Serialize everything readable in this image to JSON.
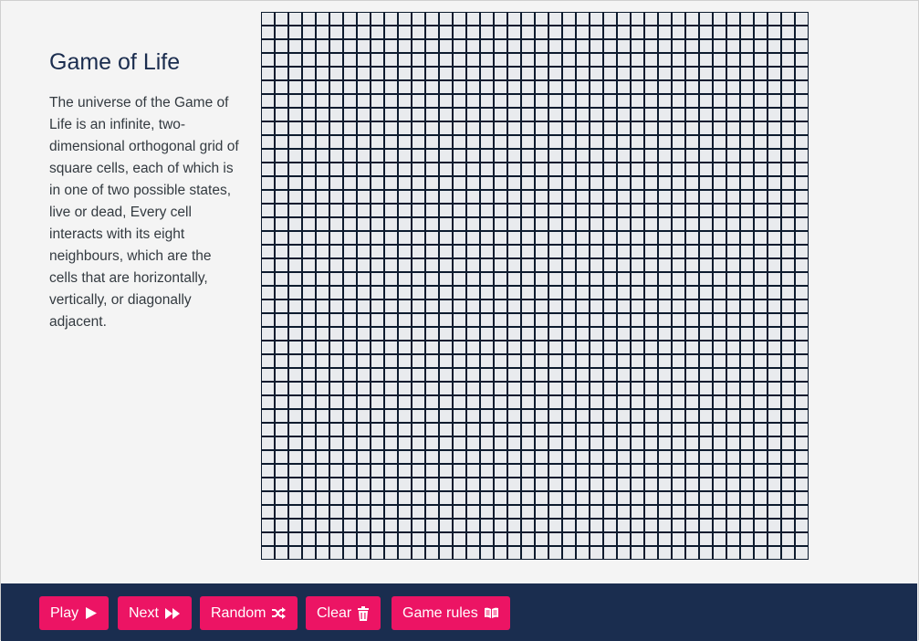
{
  "info": {
    "title": "Game of Life",
    "description": "The universe of the Game of Life is an infinite, two-dimensional orthogonal grid of square cells, each of which is in one of two possible states, live or dead, Every cell interacts with its eight neighbours, which are the cells that are horizontally, vertically, or diagonally adjacent."
  },
  "grid": {
    "rows": 40,
    "cols": 40,
    "live_cells": [],
    "dead_color": "#e9ebee",
    "live_color": "#ec1464",
    "border_color": "#0d1b2e"
  },
  "toolbar": {
    "background": "#1a2d4f",
    "button_color": "#ec1464",
    "buttons": [
      {
        "label": "Play",
        "icon": "play-icon"
      },
      {
        "label": "Next",
        "icon": "fast-forward-icon"
      },
      {
        "label": "Random",
        "icon": "shuffle-icon"
      },
      {
        "label": "Clear",
        "icon": "trash-icon"
      },
      {
        "label": "Game rules",
        "icon": "book-icon"
      }
    ]
  }
}
